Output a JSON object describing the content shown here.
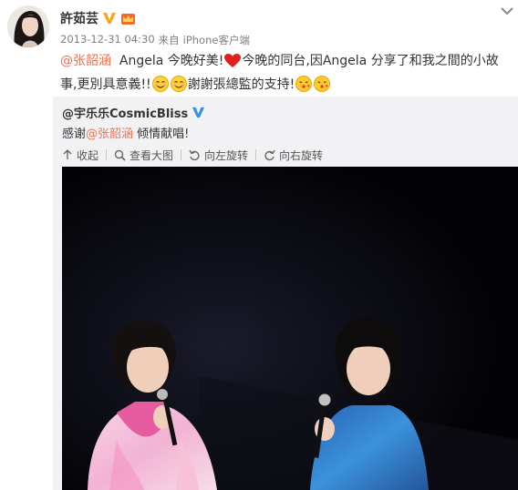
{
  "post": {
    "author_name": "許茹芸",
    "timestamp": "2013-12-31 04:30",
    "source_prefix": "来自",
    "source": "iPhone客户端",
    "text_mention": "@张韶涵",
    "text_part1": "Angela 今晚好美!",
    "text_part2": "今晚的同台,因Angela 分享了和我之間的小故事,更別具意義!!",
    "text_part3": "謝謝張總監的支持!"
  },
  "repost": {
    "author_name": "@宇乐乐CosmicBliss",
    "text_prefix": "感谢",
    "text_mention": "@张韶涵",
    "text_suffix": " 倾情献唱!",
    "actions": {
      "collapse": "收起",
      "view_large": "查看大图",
      "rotate_left": "向左旋转",
      "rotate_right": "向右旋转"
    }
  },
  "icons": {
    "verified": "verified-v-badge-icon",
    "member": "crown-member-icon",
    "expand": "chevron-down-icon",
    "heart": "red-heart-emoji",
    "smile": "smile-emoji",
    "kiss": "kiss-emoji"
  },
  "colors": {
    "mention": "#eb7350",
    "verified_author": "#f5a623",
    "verified_repost": "#3c8fdc",
    "repost_bg": "#f2f2f5"
  }
}
